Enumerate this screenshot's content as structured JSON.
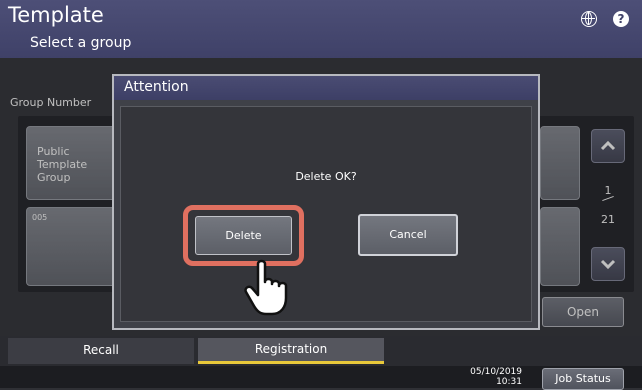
{
  "header": {
    "title": "Template",
    "subtitle": "Select a group",
    "icons": [
      "globe-icon",
      "help-icon"
    ],
    "help_glyph": "?"
  },
  "list": {
    "label": "Group Number",
    "tiles": [
      {
        "name": "Public\nTemplate\nGroup"
      },
      {
        "number": "005"
      }
    ],
    "page_current": "1",
    "page_total": "21",
    "open_label": "Open"
  },
  "tabs": [
    {
      "label": "Recall",
      "active": false
    },
    {
      "label": "Registration",
      "active": true
    }
  ],
  "footer": {
    "date": "05/10/2019",
    "time": "10:31",
    "job_status_label": "Job Status"
  },
  "dialog": {
    "title": "Attention",
    "message": "Delete OK?",
    "delete_label": "Delete",
    "cancel_label": "Cancel"
  },
  "colors": {
    "header": "#3f4168",
    "highlight": "#e07060",
    "tab_active_underline": "#e8c83a"
  }
}
